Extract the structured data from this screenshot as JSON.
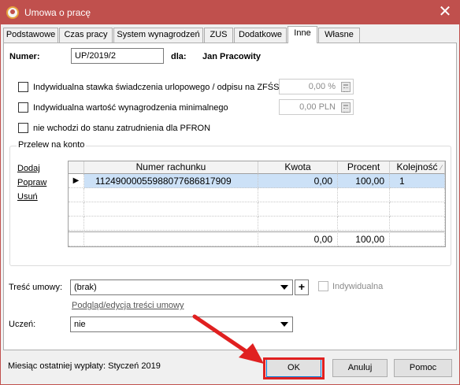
{
  "window": {
    "title": "Umowa o pracę",
    "close_glyph": "✕"
  },
  "tabs": [
    {
      "label": "Podstawowe"
    },
    {
      "label": "Czas pracy"
    },
    {
      "label": "System wynagrodzeń"
    },
    {
      "label": "ZUS"
    },
    {
      "label": "Dodatkowe"
    },
    {
      "label": "Inne",
      "active": true
    },
    {
      "label": "Własne"
    }
  ],
  "header": {
    "numer_label": "Numer:",
    "numer_value": "UP/2019/2",
    "dla_label": "dla:",
    "employee_name": "Jan Pracowity"
  },
  "options": {
    "stawka_label": "Indywidualna stawka świadczenia urlopowego / odpisu na ZFŚS",
    "stawka_value": "0,00 %",
    "wynagrodzenie_label": "Indywidualna wartość wynagrodzenia minimalnego",
    "wynagrodzenie_value": "0,00 PLN",
    "pfron_label": "nie wchodzi do stanu zatrudnienia dla PFRON"
  },
  "przelew": {
    "title": "Przelew na konto",
    "links": {
      "dodaj": "Dodaj",
      "popraw": "Popraw",
      "usun": "Usuń"
    },
    "columns": [
      "Numer rachunku",
      "Kwota",
      "Procent",
      "Kolejność"
    ],
    "rows": [
      {
        "marker": "▶",
        "numer": "11249000055988077686817909",
        "kwota": "0,00",
        "procent": "100,00",
        "kolejnosc": "1"
      }
    ],
    "footer": {
      "kwota": "0,00",
      "procent": "100,00"
    }
  },
  "tresc": {
    "label": "Treść umowy:",
    "value": "(brak)",
    "plus": "+",
    "indywidualna_label": "Indywidualna",
    "podglad_link": "Podgląd/edycja treści umowy"
  },
  "uczen": {
    "label": "Uczeń:",
    "value": "nie"
  },
  "footer": {
    "status": "Miesiąc ostatniej wypłaty: Styczeń 2019",
    "ok": "OK",
    "anuluj": "Anuluj",
    "pomoc": "Pomoc"
  },
  "colors": {
    "titlebar": "#c0504d",
    "selection": "#cce1f7",
    "annotation": "#e02020"
  }
}
